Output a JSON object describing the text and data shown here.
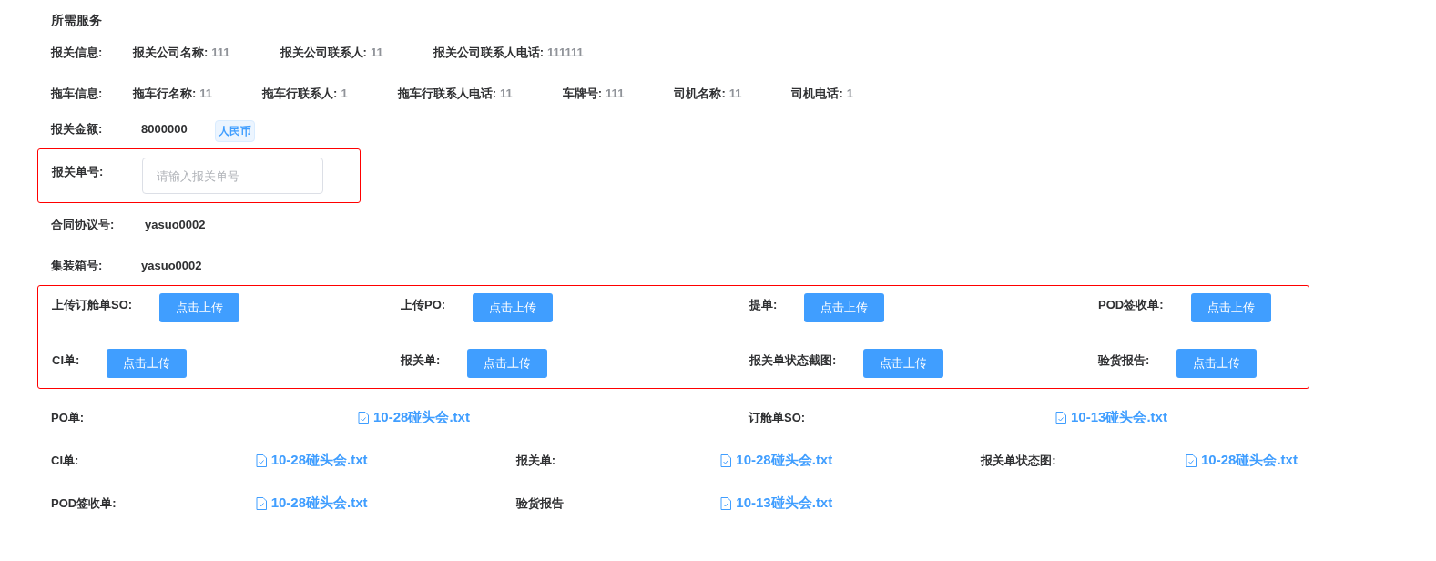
{
  "section_title": "所需服务",
  "info_rows": [
    {
      "label": "报关信息:",
      "fields": [
        {
          "name": "报关公司名称:",
          "value": "111"
        },
        {
          "name": "报关公司联系人:",
          "value": "11"
        },
        {
          "name": "报关公司联系人电话:",
          "value": "111111"
        }
      ]
    },
    {
      "label": "拖车信息:",
      "fields": [
        {
          "name": "拖车行名称:",
          "value": "11"
        },
        {
          "name": "拖车行联系人:",
          "value": "1"
        },
        {
          "name": "拖车行联系人电话:",
          "value": "11"
        },
        {
          "name": "车牌号:",
          "value": "111"
        },
        {
          "name": "司机名称:",
          "value": "11"
        },
        {
          "name": "司机电话:",
          "value": "1"
        }
      ]
    }
  ],
  "amount": {
    "label": "报关金额:",
    "value": "8000000",
    "currency": "人民币"
  },
  "declaration_number": {
    "label": "报关单号:",
    "placeholder": "请输入报关单号",
    "outlined": true
  },
  "contract": {
    "label": "合同协议号:",
    "value": "yasuo0002"
  },
  "container": {
    "label": "集装箱号:",
    "value": "yasuo0002"
  },
  "uploads": {
    "outlined": true,
    "items": [
      {
        "label": "上传订舱单SO:",
        "button": "点击上传"
      },
      {
        "label": "上传PO:",
        "button": "点击上传"
      },
      {
        "label": "提单:",
        "button": "点击上传"
      },
      {
        "label": "POD签收单:",
        "button": "点击上传"
      },
      {
        "label": "CI单:",
        "button": "点击上传"
      },
      {
        "label": "报关单:",
        "button": "点击上传"
      },
      {
        "label": "报关单状态截图:",
        "button": "点击上传"
      },
      {
        "label": "验货报告:",
        "button": "点击上传"
      }
    ]
  },
  "file_rows": [
    {
      "items": [
        {
          "label": "PO单:",
          "file": "10-28碰头会.txt"
        },
        {
          "label": "订舱单SO:",
          "file": "10-13碰头会.txt"
        }
      ]
    },
    {
      "items": [
        {
          "label": "CI单:",
          "file": "10-28碰头会.txt"
        },
        {
          "label": "报关单:",
          "file": "10-28碰头会.txt"
        },
        {
          "label": "报关单状态图:",
          "file": "10-28碰头会.txt"
        }
      ]
    },
    {
      "items": [
        {
          "label": "POD签收单:",
          "file": "10-28碰头会.txt"
        },
        {
          "label": "验货报告",
          "file": "10-13碰头会.txt"
        }
      ]
    }
  ]
}
